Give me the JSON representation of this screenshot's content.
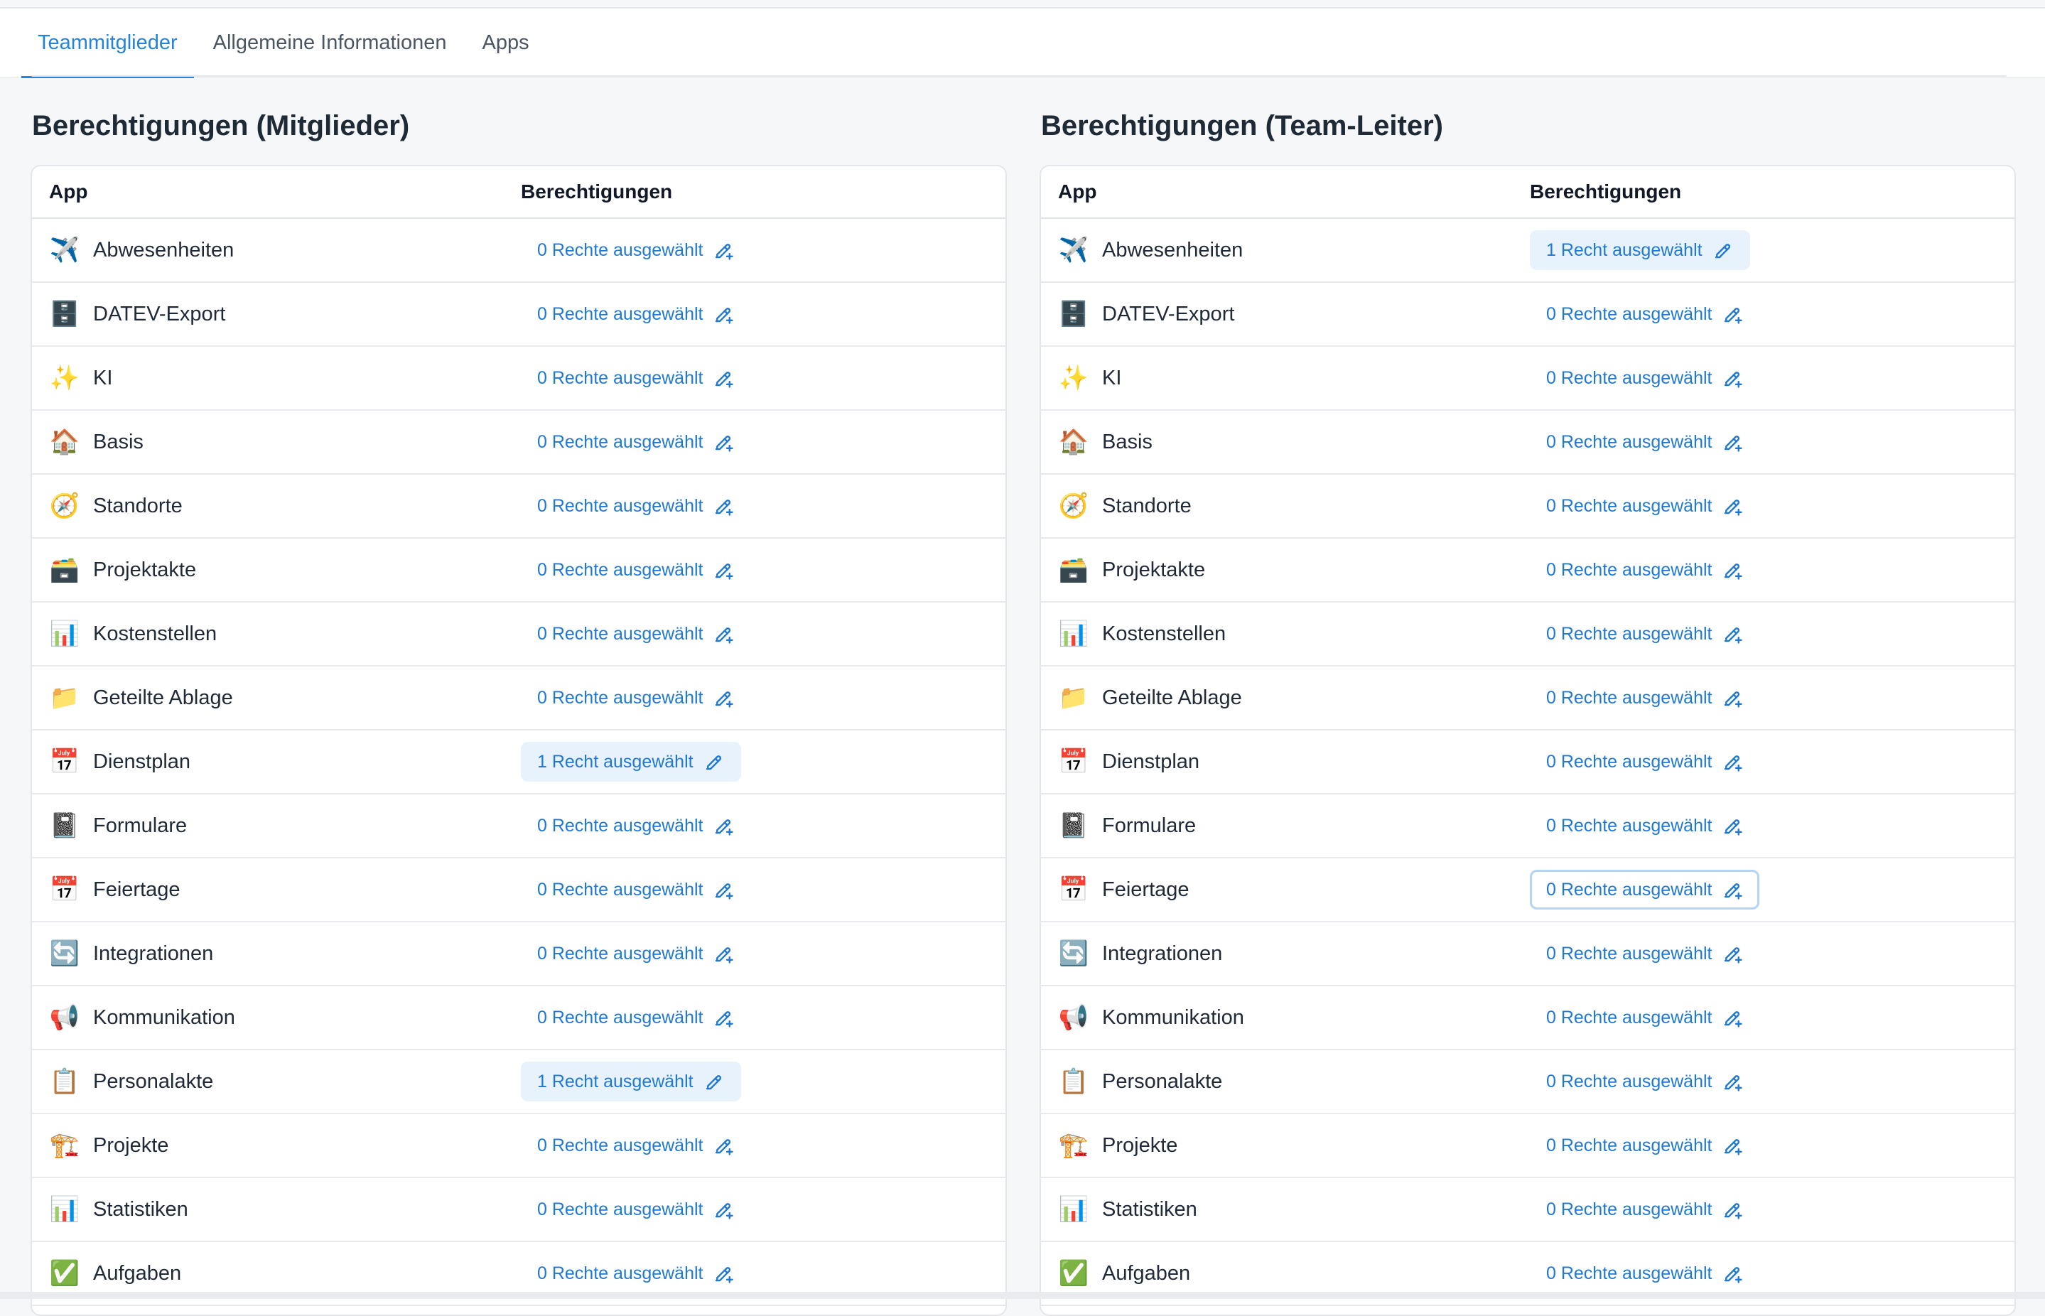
{
  "tabs": [
    {
      "label": "Teammitglieder",
      "active": true
    },
    {
      "label": "Allgemeine Informationen",
      "active": false
    },
    {
      "label": "Apps",
      "active": false
    }
  ],
  "columns": {
    "app": "App",
    "permissions": "Berechtigungen"
  },
  "panels": [
    {
      "title": "Berechtigungen (Mitglieder)",
      "rows": [
        {
          "icon": "airplane-icon",
          "glyph": "✈️",
          "name": "Abwesenheiten",
          "perm": "0 Rechte ausgewählt",
          "set": false
        },
        {
          "icon": "filing-cabinet-icon",
          "glyph": "🗄️",
          "name": "DATEV-Export",
          "perm": "0 Rechte ausgewählt",
          "set": false
        },
        {
          "icon": "sparkles-icon",
          "glyph": "✨",
          "name": "KI",
          "perm": "0 Rechte ausgewählt",
          "set": false
        },
        {
          "icon": "house-icon",
          "glyph": "🏠",
          "name": "Basis",
          "perm": "0 Rechte ausgewählt",
          "set": false
        },
        {
          "icon": "compass-icon",
          "glyph": "🧭",
          "name": "Standorte",
          "perm": "0 Rechte ausgewählt",
          "set": false
        },
        {
          "icon": "card-file-box-icon",
          "glyph": "🗃️",
          "name": "Projektakte",
          "perm": "0 Rechte ausgewählt",
          "set": false
        },
        {
          "icon": "bar-chart-icon",
          "glyph": "📊",
          "name": "Kostenstellen",
          "perm": "0 Rechte ausgewählt",
          "set": false
        },
        {
          "icon": "folder-icon",
          "glyph": "📁",
          "name": "Geteilte Ablage",
          "perm": "0 Rechte ausgewählt",
          "set": false
        },
        {
          "icon": "calendar-icon",
          "glyph": "📅",
          "name": "Dienstplan",
          "perm": "1 Recht ausgewählt",
          "set": true
        },
        {
          "icon": "notebook-icon",
          "glyph": "📓",
          "name": "Formulare",
          "perm": "0 Rechte ausgewählt",
          "set": false
        },
        {
          "icon": "calendar-icon",
          "glyph": "📅",
          "name": "Feiertage",
          "perm": "0 Rechte ausgewählt",
          "set": false
        },
        {
          "icon": "refresh-icon",
          "glyph": "🔄",
          "name": "Integrationen",
          "perm": "0 Rechte ausgewählt",
          "set": false
        },
        {
          "icon": "megaphone-icon",
          "glyph": "📢",
          "name": "Kommunikation",
          "perm": "0 Rechte ausgewählt",
          "set": false
        },
        {
          "icon": "clipboard-icon",
          "glyph": "📋",
          "name": "Personalakte",
          "perm": "1 Recht ausgewählt",
          "set": true
        },
        {
          "icon": "construction-icon",
          "glyph": "🏗️",
          "name": "Projekte",
          "perm": "0 Rechte ausgewählt",
          "set": false
        },
        {
          "icon": "bar-chart-icon",
          "glyph": "📊",
          "name": "Statistiken",
          "perm": "0 Rechte ausgewählt",
          "set": false
        },
        {
          "icon": "check-mark-icon",
          "glyph": "✅",
          "name": "Aufgaben",
          "perm": "0 Rechte ausgewählt",
          "set": false
        }
      ]
    },
    {
      "title": "Berechtigungen (Team-Leiter)",
      "rows": [
        {
          "icon": "airplane-icon",
          "glyph": "✈️",
          "name": "Abwesenheiten",
          "perm": "1 Recht ausgewählt",
          "set": true
        },
        {
          "icon": "filing-cabinet-icon",
          "glyph": "🗄️",
          "name": "DATEV-Export",
          "perm": "0 Rechte ausgewählt",
          "set": false
        },
        {
          "icon": "sparkles-icon",
          "glyph": "✨",
          "name": "KI",
          "perm": "0 Rechte ausgewählt",
          "set": false
        },
        {
          "icon": "house-icon",
          "glyph": "🏠",
          "name": "Basis",
          "perm": "0 Rechte ausgewählt",
          "set": false
        },
        {
          "icon": "compass-icon",
          "glyph": "🧭",
          "name": "Standorte",
          "perm": "0 Rechte ausgewählt",
          "set": false
        },
        {
          "icon": "card-file-box-icon",
          "glyph": "🗃️",
          "name": "Projektakte",
          "perm": "0 Rechte ausgewählt",
          "set": false
        },
        {
          "icon": "bar-chart-icon",
          "glyph": "📊",
          "name": "Kostenstellen",
          "perm": "0 Rechte ausgewählt",
          "set": false
        },
        {
          "icon": "folder-icon",
          "glyph": "📁",
          "name": "Geteilte Ablage",
          "perm": "0 Rechte ausgewählt",
          "set": false
        },
        {
          "icon": "calendar-icon",
          "glyph": "📅",
          "name": "Dienstplan",
          "perm": "0 Rechte ausgewählt",
          "set": false
        },
        {
          "icon": "notebook-icon",
          "glyph": "📓",
          "name": "Formulare",
          "perm": "0 Rechte ausgewählt",
          "set": false
        },
        {
          "icon": "calendar-icon",
          "glyph": "📅",
          "name": "Feiertage",
          "perm": "0 Rechte ausgewählt",
          "set": false,
          "focus": true
        },
        {
          "icon": "refresh-icon",
          "glyph": "🔄",
          "name": "Integrationen",
          "perm": "0 Rechte ausgewählt",
          "set": false
        },
        {
          "icon": "megaphone-icon",
          "glyph": "📢",
          "name": "Kommunikation",
          "perm": "0 Rechte ausgewählt",
          "set": false
        },
        {
          "icon": "clipboard-icon",
          "glyph": "📋",
          "name": "Personalakte",
          "perm": "0 Rechte ausgewählt",
          "set": false
        },
        {
          "icon": "construction-icon",
          "glyph": "🏗️",
          "name": "Projekte",
          "perm": "0 Rechte ausgewählt",
          "set": false
        },
        {
          "icon": "bar-chart-icon",
          "glyph": "📊",
          "name": "Statistiken",
          "perm": "0 Rechte ausgewählt",
          "set": false
        },
        {
          "icon": "check-mark-icon",
          "glyph": "✅",
          "name": "Aufgaben",
          "perm": "0 Rechte ausgewählt",
          "set": false
        }
      ]
    }
  ],
  "colors": {
    "accent": "#2484d8",
    "link": "#1f78d1",
    "selected_bg": "#e8f2fd",
    "focus_border": "#b3d4f5"
  }
}
